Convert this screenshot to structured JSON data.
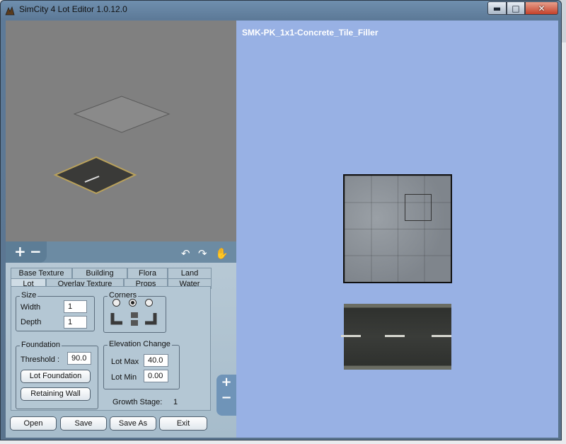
{
  "window": {
    "title": "SimCity 4 Lot Editor 1.0.12.0",
    "minimize_label": "▬",
    "maximize_label": "□",
    "close_label": "✕"
  },
  "preview": {
    "zoom_in": "+",
    "zoom_out": "−"
  },
  "tabs": {
    "row1": [
      "Base Texture",
      "Building",
      "Flora",
      "Land"
    ],
    "row2": [
      "Lot",
      "Overlay Texture",
      "Props",
      "Water"
    ],
    "active": "Lot"
  },
  "lot_tab": {
    "size": {
      "label": "Size",
      "width_label": "Width",
      "width_value": "1",
      "depth_label": "Depth",
      "depth_value": "1"
    },
    "corners": {
      "label": "Corners",
      "selected_index": 1
    },
    "foundation": {
      "label": "Foundation",
      "threshold_label": "Threshold :",
      "threshold_value": "90.0",
      "lot_foundation_button": "Lot Foundation",
      "retaining_wall_button": "Retaining Wall"
    },
    "elevation": {
      "label": "Elevation Change",
      "lot_max_label": "Lot Max",
      "lot_max_value": "40.0",
      "lot_min_label": "Lot Min",
      "lot_min_value": "0.00"
    },
    "growth_stage_label": "Growth Stage:",
    "growth_stage_value": "1"
  },
  "buttons": {
    "open": "Open",
    "save": "Save",
    "save_as": "Save As",
    "exit": "Exit"
  },
  "editor": {
    "lot_name": "SMK-PK_1x1-Concrete_Tile_Filler",
    "zoom_in": "+",
    "zoom_out": "−"
  },
  "colors": {
    "editor_background": "#98b1e4",
    "preview_background": "#808080",
    "panel_background": "#b4c7d4"
  }
}
